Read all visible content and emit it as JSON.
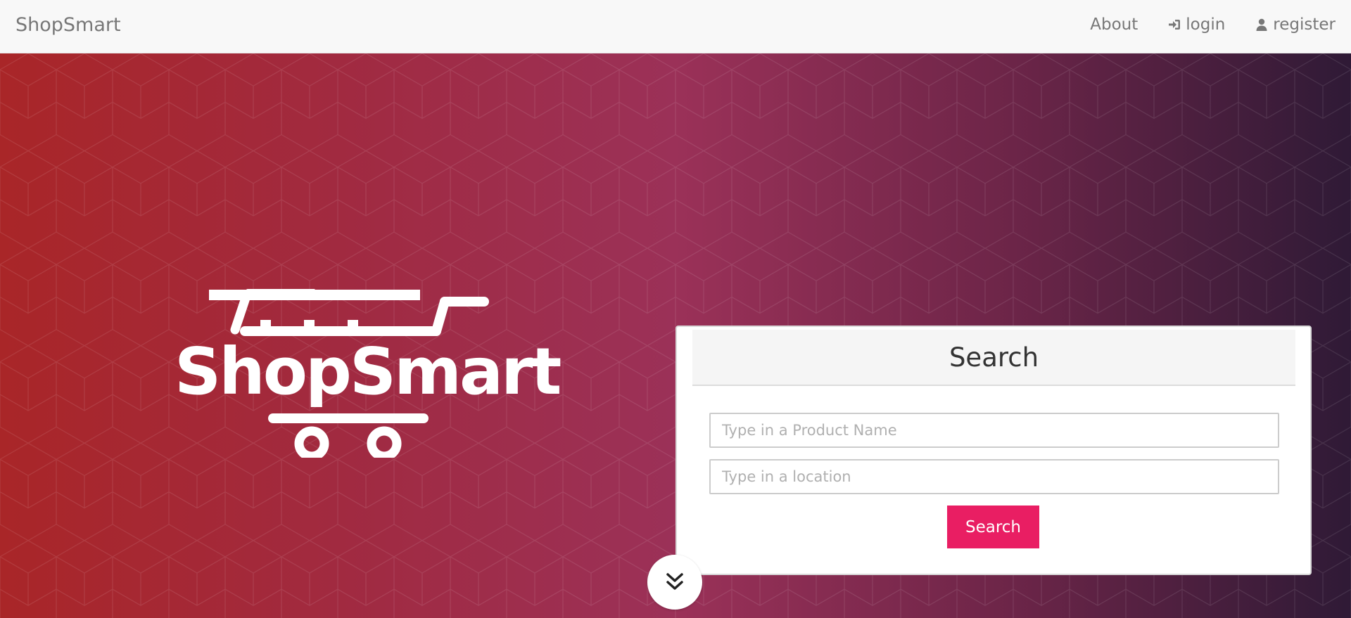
{
  "navbar": {
    "brand": "ShopSmart",
    "links": [
      {
        "label": "About",
        "icon": null
      },
      {
        "label": "login",
        "icon": "sign-in-icon"
      },
      {
        "label": "register",
        "icon": "user-icon"
      }
    ]
  },
  "hero": {
    "logo_text": "ShopSmart",
    "search": {
      "title": "Search",
      "product_placeholder": "Type in a Product Name",
      "location_placeholder": "Type in a location",
      "button_label": "Search"
    },
    "scroll_icon": "double-chevron-down-icon"
  },
  "colors": {
    "accent": "#e91e63",
    "gradient_start": "#a92628",
    "gradient_end": "#2f1a36"
  }
}
